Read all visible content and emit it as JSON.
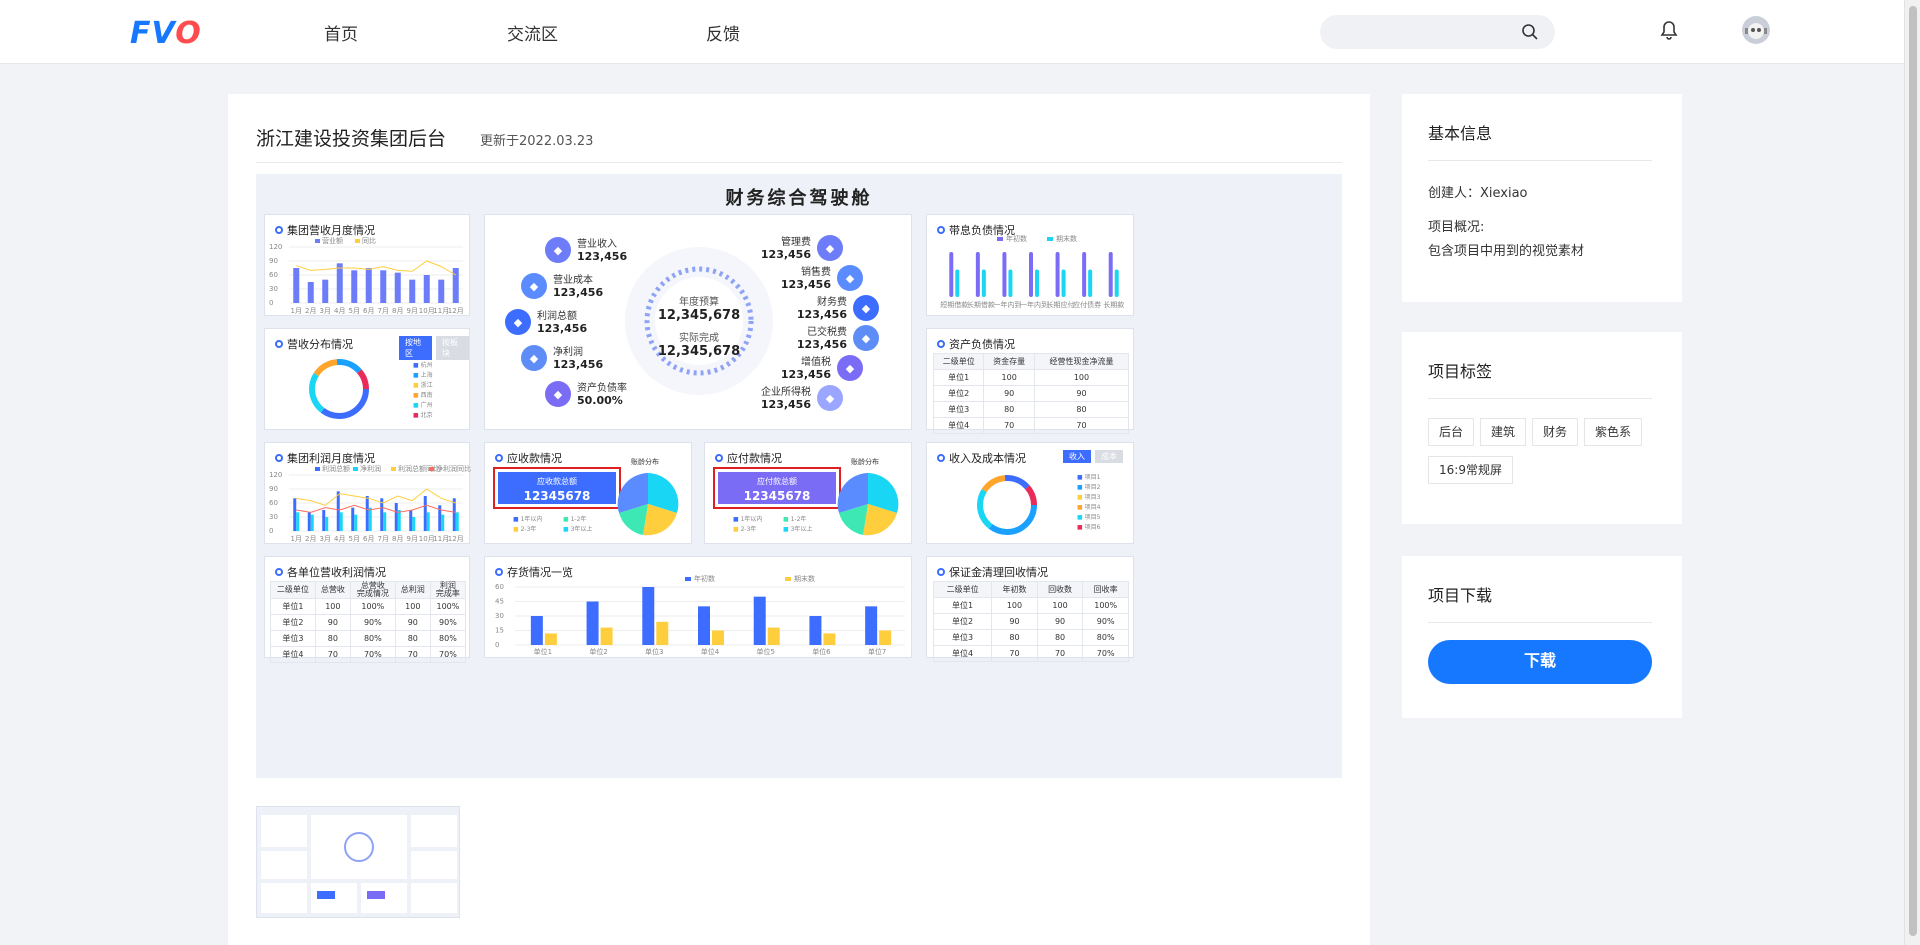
{
  "nav": {
    "logo_a": "FV",
    "logo_b": "O",
    "items": [
      "首页",
      "交流区",
      "反馈"
    ],
    "search_placeholder": ""
  },
  "project": {
    "title": "浙江建设投资集团后台",
    "updated": "更新于2022.03.23"
  },
  "dashboard": {
    "title": "财务综合驾驶舱",
    "revenue_monthly": {
      "title": "集团营收月度情况",
      "legend": [
        "营业额",
        "同比"
      ],
      "y_ticks": [
        "120",
        "90",
        "60",
        "30",
        "0"
      ],
      "months": [
        "1月",
        "2月",
        "3月",
        "4月",
        "5月",
        "6月",
        "7月",
        "8月",
        "9月",
        "10月",
        "11月",
        "12月"
      ]
    },
    "revenue_dist": {
      "title": "营收分布情况",
      "toggles": [
        "按地区",
        "按板块"
      ],
      "legend": [
        "杭州",
        "上海",
        "浙江",
        "西南",
        "广州",
        "北京"
      ]
    },
    "profit_monthly": {
      "title": "集团利润月度情况",
      "legend": [
        "利润总额",
        "净利润",
        "利润总额同比",
        "净利润同比"
      ],
      "y_ticks": [
        "120",
        "90",
        "60",
        "30",
        "0"
      ],
      "months": [
        "1月",
        "2月",
        "3月",
        "4月",
        "5月",
        "6月",
        "7月",
        "8月",
        "9月",
        "10月",
        "11月",
        "12月"
      ]
    },
    "unit_profit": {
      "title": "各单位营收利润情况",
      "headers": [
        "二级单位",
        "总营收",
        "总营收\n完成情况",
        "总利润",
        "利润\n完成率"
      ],
      "rows": [
        [
          "单位1",
          "100",
          "100%",
          "100",
          "100%"
        ],
        [
          "单位2",
          "90",
          "90%",
          "90",
          "90%"
        ],
        [
          "单位3",
          "80",
          "80%",
          "80",
          "80%"
        ],
        [
          "单位4",
          "70",
          "70%",
          "70",
          "70%"
        ]
      ]
    },
    "center": {
      "budget_label": "年度预算",
      "budget_value": "12,345,678",
      "actual_label": "实际完成",
      "actual_value": "12,345,678",
      "left": [
        {
          "label": "营业收入",
          "value": "123,456"
        },
        {
          "label": "营业成本",
          "value": "123,456"
        },
        {
          "label": "利润总额",
          "value": "123,456"
        },
        {
          "label": "净利润",
          "value": "123,456"
        },
        {
          "label": "资产负债率",
          "value": "50.00%"
        }
      ],
      "right": [
        {
          "label": "管理费",
          "value": "123,456"
        },
        {
          "label": "销售费",
          "value": "123,456"
        },
        {
          "label": "财务费",
          "value": "123,456"
        },
        {
          "label": "已交税费",
          "value": "123,456"
        },
        {
          "label": "增值税",
          "value": "123,456"
        },
        {
          "label": "企业所得税",
          "value": "123,456"
        }
      ]
    },
    "receivable": {
      "title": "应收款情况",
      "box_label": "应收款总额",
      "box_value": "12345678",
      "pie_title": "账龄分布",
      "legend": [
        "1年以内",
        "1-2年",
        "2-3年",
        "3年以上"
      ]
    },
    "payable": {
      "title": "应付款情况",
      "box_label": "应付款总额",
      "box_value": "12345678",
      "pie_title": "账龄分布",
      "legend": [
        "1年以内",
        "1-2年",
        "2-3年",
        "3年以上"
      ]
    },
    "debt": {
      "title": "带息负债情况",
      "legend": [
        "年初数",
        "期末数"
      ],
      "cats": [
        "短期借款",
        "长期借款",
        "一年内到期长期借款",
        "一年内到期融资租赁",
        "长期应付款",
        "应付债券",
        "长期款"
      ]
    },
    "balance": {
      "title": "资产负债情况",
      "headers": [
        "二级单位",
        "资金存量",
        "经营性现金净流量"
      ],
      "rows": [
        [
          "单位1",
          "100",
          "100"
        ],
        [
          "单位2",
          "90",
          "90"
        ],
        [
          "单位3",
          "80",
          "80"
        ],
        [
          "单位4",
          "70",
          "70"
        ]
      ]
    },
    "income_cost": {
      "title": "收入及成本情况",
      "toggles": [
        "收入",
        "成本"
      ],
      "legend": [
        "项目1",
        "项目2",
        "项目3",
        "项目4",
        "项目5",
        "项目6"
      ]
    },
    "inventory": {
      "title": "存货情况一览",
      "legend": [
        "年初数",
        "期末数"
      ],
      "y_ticks": [
        "60",
        "45",
        "30",
        "15",
        "0"
      ],
      "cats": [
        "单位1",
        "单位2",
        "单位3",
        "单位4",
        "单位5",
        "单位6",
        "单位7"
      ]
    },
    "deposit": {
      "title": "保证金清理回收情况",
      "headers": [
        "二级单位",
        "年初数",
        "回收数",
        "回收率"
      ],
      "rows": [
        [
          "单位1",
          "100",
          "100",
          "100%"
        ],
        [
          "单位2",
          "90",
          "90",
          "90%"
        ],
        [
          "单位3",
          "80",
          "80",
          "80%"
        ],
        [
          "单位4",
          "70",
          "70",
          "70%"
        ]
      ]
    }
  },
  "chart_data": [
    {
      "type": "bar",
      "title": "集团营收月度情况",
      "categories": [
        "1月",
        "2月",
        "3月",
        "4月",
        "5月",
        "6月",
        "7月",
        "8月",
        "9月",
        "10月",
        "11月",
        "12月"
      ],
      "series": [
        {
          "name": "营业额",
          "values": [
            75,
            45,
            50,
            85,
            70,
            75,
            70,
            65,
            50,
            60,
            50,
            75
          ]
        },
        {
          "name": "同比",
          "values": [
            80,
            70,
            72,
            75,
            75,
            72,
            78,
            70,
            68,
            90,
            78,
            60
          ]
        }
      ],
      "ylim": [
        0,
        120
      ]
    },
    {
      "type": "bar",
      "title": "集团利润月度情况",
      "categories": [
        "1月",
        "2月",
        "3月",
        "4月",
        "5月",
        "6月",
        "7月",
        "8月",
        "9月",
        "10月",
        "11月",
        "12月"
      ],
      "series": [
        {
          "name": "利润总额",
          "values": [
            70,
            40,
            45,
            85,
            50,
            75,
            70,
            60,
            45,
            75,
            55,
            70
          ]
        },
        {
          "name": "净利润",
          "values": [
            40,
            35,
            30,
            40,
            35,
            50,
            40,
            45,
            30,
            40,
            35,
            40
          ]
        },
        {
          "name": "利润总额同比",
          "values": [
            70,
            65,
            55,
            80,
            75,
            70,
            60,
            75,
            65,
            90,
            70,
            60
          ]
        },
        {
          "name": "净利润同比",
          "values": [
            45,
            40,
            50,
            45,
            55,
            45,
            50,
            40,
            45,
            55,
            45,
            40
          ]
        }
      ],
      "ylim": [
        0,
        120
      ]
    },
    {
      "type": "bar",
      "title": "存货情况一览",
      "categories": [
        "单位1",
        "单位2",
        "单位3",
        "单位4",
        "单位5",
        "单位6",
        "单位7"
      ],
      "series": [
        {
          "name": "年初数",
          "values": [
            30,
            45,
            60,
            40,
            50,
            30,
            40
          ]
        },
        {
          "name": "期末数",
          "values": [
            12,
            18,
            24,
            15,
            18,
            12,
            15
          ]
        }
      ],
      "ylim": [
        0,
        60
      ]
    },
    {
      "type": "bar",
      "title": "带息负债情况",
      "categories": [
        "短期借款",
        "长期借款",
        "一年内到期长期借款",
        "一年内到期融资租赁",
        "长期应付款",
        "应付债券",
        "长期款"
      ],
      "series": [
        {
          "name": "年初数",
          "values": [
            90,
            90,
            90,
            90,
            90,
            90,
            90
          ]
        },
        {
          "name": "期末数",
          "values": [
            55,
            55,
            55,
            55,
            55,
            55,
            55
          ]
        }
      ]
    }
  ],
  "sidebar": {
    "info_title": "基本信息",
    "creator": "创建人：Xiexiao",
    "overview_label": "项目概况:",
    "overview": "包含项目中用到的视觉素材",
    "tags_title": "项目标签",
    "tags": [
      "后台",
      "建筑",
      "财务",
      "紫色系",
      "16:9常规屏"
    ],
    "download_title": "项目下载",
    "download_btn": "下载"
  },
  "colors": {
    "primary": "#1677ff",
    "blue": "#3d6dff",
    "cyan": "#1ad6f5",
    "yellow": "#ffce3d",
    "red": "#e02020",
    "purple": "#7b6cf6"
  }
}
